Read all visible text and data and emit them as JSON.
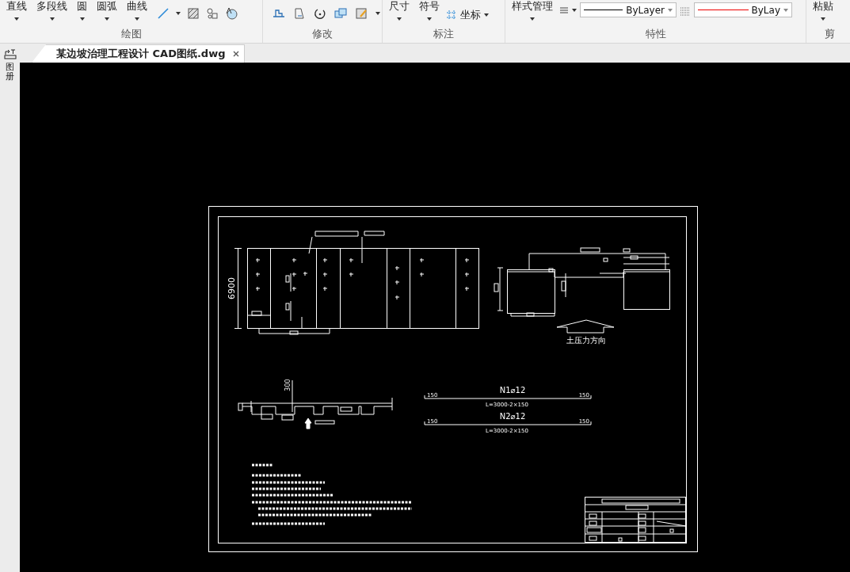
{
  "ribbon": {
    "groups": [
      {
        "kind": "draw",
        "label": "绘图",
        "buttons": [
          {
            "label": "直线"
          },
          {
            "label": "多段线"
          },
          {
            "label": "圆"
          },
          {
            "label": "圆弧"
          },
          {
            "label": "曲线"
          }
        ]
      },
      {
        "kind": "modify",
        "label": "修改"
      },
      {
        "kind": "annotate",
        "label": "标注",
        "buttons": [
          {
            "label": "尺寸"
          },
          {
            "label": "符号"
          }
        ],
        "small_buttons": [
          {
            "label": "坐标"
          }
        ]
      },
      {
        "kind": "properties",
        "label": "特性",
        "buttons": [
          {
            "label": "样式管理"
          }
        ],
        "linetype": {
          "value": "ByLayer"
        },
        "lineweight": {
          "value": "ByLay"
        }
      },
      {
        "kind": "clipboard",
        "label": "剪",
        "buttons": [
          {
            "label": "粘贴"
          }
        ]
      }
    ]
  },
  "side_panel": {
    "label": "图册"
  },
  "document_tabs": [
    {
      "label": "某边坡治理工程设计 CAD图纸.dwg",
      "selected": true
    }
  ],
  "drawing": {
    "plan_dimension": "6900",
    "pressure_label": "土压力方向",
    "section_dimension": "300",
    "rebars": [
      {
        "name": "N1⌀12",
        "left_hook": "150",
        "right_hook": "150",
        "length": "L=3000-2×150"
      },
      {
        "name": "N2⌀12",
        "left_hook": "150",
        "right_hook": "150",
        "length": "L=3000-2×150"
      }
    ]
  }
}
